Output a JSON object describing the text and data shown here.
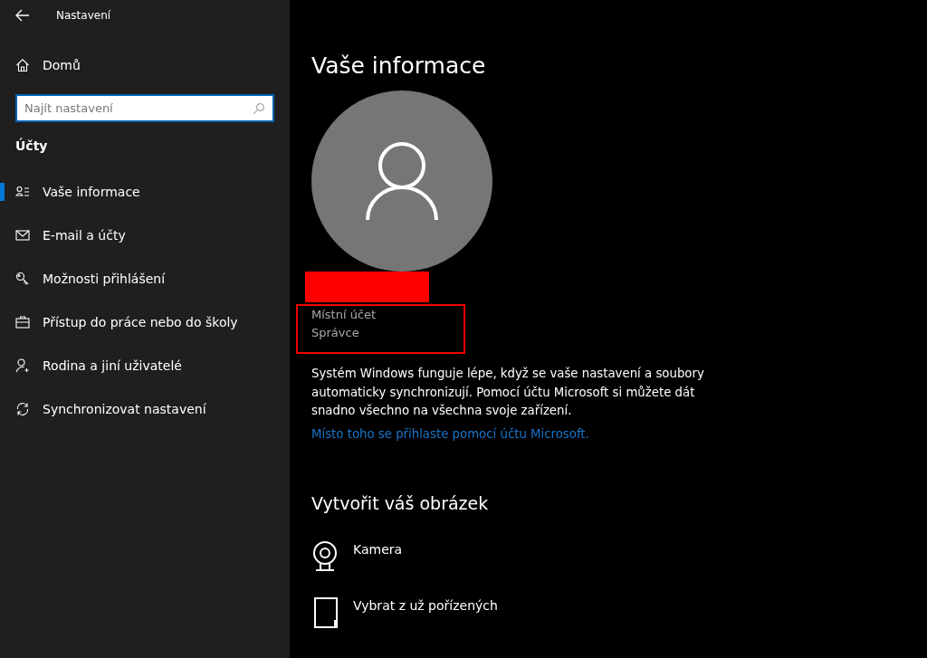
{
  "window": {
    "title": "Nastavení"
  },
  "home": {
    "label": "Domů"
  },
  "search": {
    "placeholder": "Najít nastavení"
  },
  "section_title": "Účty",
  "nav_items": [
    {
      "label": "Vaše informace",
      "kind": "info",
      "selected": true
    },
    {
      "label": "E-mail a účty",
      "kind": "mail",
      "selected": false
    },
    {
      "label": "Možnosti přihlášení",
      "kind": "key",
      "selected": false
    },
    {
      "label": "Přístup do práce nebo do školy",
      "kind": "briefcase",
      "selected": false
    },
    {
      "label": "Rodina a jiní uživatelé",
      "kind": "family",
      "selected": false
    },
    {
      "label": "Synchronizovat nastavení",
      "kind": "sync",
      "selected": false
    }
  ],
  "page_title": "Vaše informace",
  "account": {
    "lines": [
      "Místní účet",
      "Správce"
    ]
  },
  "description": "Systém Windows funguje lépe, když se vaše nastavení a soubory automaticky synchronizují. Pomocí účtu Microsoft si můžete dát snadno všechno na všechna svoje zařízení.",
  "link": "Místo toho se přihlaste pomocí účtu Microsoft.",
  "picture_section": {
    "title": "Vytvořit váš obrázek",
    "options": [
      {
        "label": "Kamera",
        "kind": "camera"
      },
      {
        "label": "Vybrat z už pořízených",
        "kind": "browse"
      }
    ]
  }
}
